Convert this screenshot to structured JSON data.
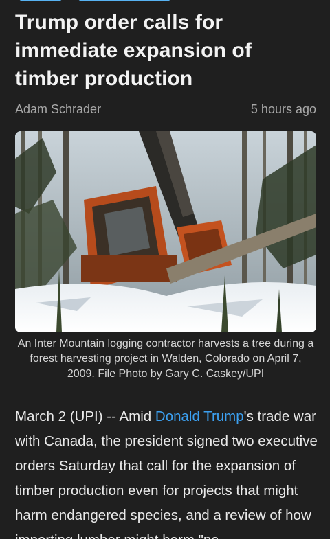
{
  "tags": [
    "",
    ""
  ],
  "article": {
    "title": "Trump order calls for immediate expansion of timber production",
    "author": "Adam Schrader",
    "time_ago": "5 hours ago",
    "image_alt": "Logging harvester machine cutting a tree in a snowy forest",
    "caption": "An Inter Mountain logging contractor harvests a tree during a forest harvesting project in Walden, Colorado on April 7, 2009. File Photo by Gary C. Caskey/UPI",
    "body": {
      "lead": "March 2 (UPI) -- Amid ",
      "link_text": "Donald Trump",
      "rest": "'s trade war with Canada, the president signed two executive orders Saturday that call for the expansion of timber production even for projects that might harm endangered species, and a review of how importing lumber might harm \"na"
    }
  },
  "colors": {
    "background": "#1f1f1f",
    "link": "#3ca0f0",
    "tag": "#1a86d6"
  }
}
